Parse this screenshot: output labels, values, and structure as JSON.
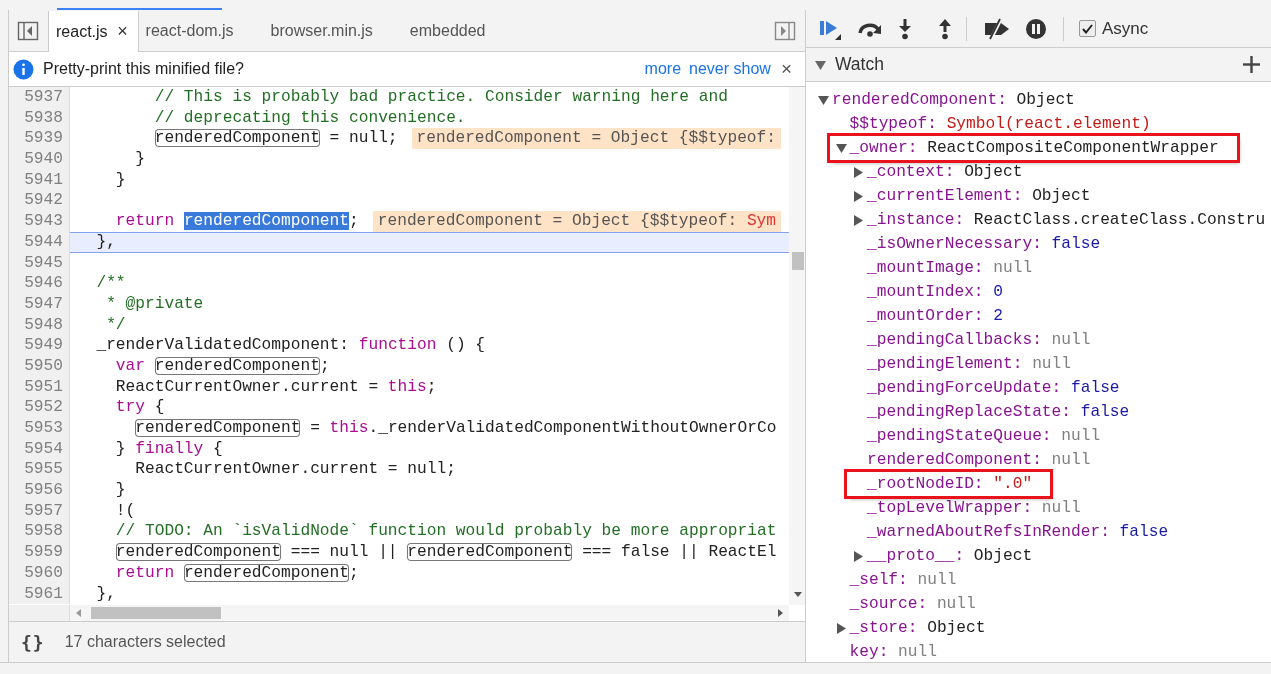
{
  "source_tabs": [
    {
      "label": "react.js",
      "selected": true,
      "close": "×"
    },
    {
      "label": "react-dom.js",
      "selected": false
    },
    {
      "label": "browser.min.js",
      "selected": false
    },
    {
      "label": "embedded",
      "selected": false
    }
  ],
  "infobar": {
    "message": "Pretty-print this minified file?",
    "links": [
      "more",
      "never show"
    ],
    "close": "×"
  },
  "code": {
    "lines": [
      {
        "number": "5937",
        "current": false,
        "tokens": [
          {
            "kind": "comment",
            "text": "        // This is probably bad practice. Consider warning here and"
          }
        ]
      },
      {
        "number": "5938",
        "current": false,
        "tokens": [
          {
            "kind": "comment",
            "text": "        // deprecating this convenience."
          }
        ]
      },
      {
        "number": "5939",
        "current": false,
        "tokens": [
          {
            "kind": "var",
            "text": "        renderedComponent"
          },
          {
            "kind": "text",
            "text": " = null;"
          }
        ],
        "inline": {
          "text": "renderedComponent = Object {$$typeof:"
        }
      },
      {
        "number": "5940",
        "current": false,
        "tokens": [
          {
            "kind": "text",
            "text": "      }"
          }
        ]
      },
      {
        "number": "5941",
        "current": false,
        "tokens": [
          {
            "kind": "text",
            "text": "    }"
          }
        ]
      },
      {
        "number": "5942",
        "current": false
      },
      {
        "number": "5943",
        "current": false,
        "tokens": [
          {
            "kind": "keyword",
            "text": "    return "
          },
          {
            "kind": "selection",
            "text": "renderedComponent"
          },
          {
            "kind": "text",
            "text": ";"
          }
        ],
        "inline": {
          "text": "renderedComponent = Object {$$typeof: ",
          "symbol": "Sym"
        }
      },
      {
        "number": "5944",
        "current": true,
        "tokens": [
          {
            "kind": "text",
            "text": "  },"
          }
        ]
      },
      {
        "number": "5945",
        "current": false
      },
      {
        "number": "5946",
        "current": false,
        "tokens": [
          {
            "kind": "comment",
            "text": "  /**"
          }
        ]
      },
      {
        "number": "5947",
        "current": false,
        "tokens": [
          {
            "kind": "comment",
            "text": "   * @private"
          }
        ]
      },
      {
        "number": "5948",
        "current": false,
        "tokens": [
          {
            "kind": "comment",
            "text": "   */"
          }
        ]
      },
      {
        "number": "5949",
        "current": false,
        "tokens": [
          {
            "kind": "text",
            "text": "  _renderValidatedComponent: "
          },
          {
            "kind": "keyword",
            "text": "function"
          },
          {
            "kind": "text",
            "text": " () {"
          }
        ]
      },
      {
        "number": "5950",
        "current": false,
        "tokens": [
          {
            "kind": "keyword",
            "text": "    var "
          },
          {
            "kind": "var",
            "text": "renderedComponent"
          },
          {
            "kind": "text",
            "text": ";"
          }
        ]
      },
      {
        "number": "5951",
        "current": false,
        "tokens": [
          {
            "kind": "text",
            "text": "    ReactCurrentOwner.current = "
          },
          {
            "kind": "keyword",
            "text": "this"
          },
          {
            "kind": "text",
            "text": ";"
          }
        ]
      },
      {
        "number": "5952",
        "current": false,
        "tokens": [
          {
            "kind": "keyword",
            "text": "    try"
          },
          {
            "kind": "text",
            "text": " {"
          }
        ]
      },
      {
        "number": "5953",
        "current": false,
        "tokens": [
          {
            "kind": "var",
            "text": "      renderedComponent"
          },
          {
            "kind": "text",
            "text": " = "
          },
          {
            "kind": "keyword",
            "text": "this"
          },
          {
            "kind": "text",
            "text": "._renderValidatedComponentWithoutOwnerOrCo"
          }
        ]
      },
      {
        "number": "5954",
        "current": false,
        "tokens": [
          {
            "kind": "text",
            "text": "    } "
          },
          {
            "kind": "keyword",
            "text": "finally"
          },
          {
            "kind": "text",
            "text": " {"
          }
        ]
      },
      {
        "number": "5955",
        "current": false,
        "tokens": [
          {
            "kind": "text",
            "text": "      ReactCurrentOwner.current = null;"
          }
        ]
      },
      {
        "number": "5956",
        "current": false,
        "tokens": [
          {
            "kind": "text",
            "text": "    }"
          }
        ]
      },
      {
        "number": "5957",
        "current": false,
        "tokens": [
          {
            "kind": "text",
            "text": "    !("
          }
        ]
      },
      {
        "number": "5958",
        "current": false,
        "tokens": [
          {
            "kind": "comment",
            "text": "    // TODO: An `isValidNode` function would probably be more appropriat"
          }
        ]
      },
      {
        "number": "5959",
        "current": false,
        "tokens": [
          {
            "kind": "var",
            "text": "    renderedComponent"
          },
          {
            "kind": "text",
            "text": " === null || "
          },
          {
            "kind": "var",
            "text": "renderedComponent"
          },
          {
            "kind": "text",
            "text": " === false || ReactEl"
          }
        ]
      },
      {
        "number": "5960",
        "current": false,
        "tokens": [
          {
            "kind": "keyword",
            "text": "    return "
          },
          {
            "kind": "var",
            "text": "renderedComponent"
          },
          {
            "kind": "text",
            "text": ";"
          }
        ]
      },
      {
        "number": "5961",
        "current": false,
        "tokens": [
          {
            "kind": "text",
            "text": "  },"
          }
        ]
      }
    ]
  },
  "status_bar": {
    "format_icon": "{}",
    "text": "17 characters selected"
  },
  "debugger_toolbar": {
    "async": {
      "label": "Async",
      "checked": true
    }
  },
  "watch": {
    "title": "Watch",
    "expanded": true,
    "items": [
      {
        "name": "renderedComponent:",
        "value": "Object",
        "kind": "object",
        "expanded": true,
        "annotated": false,
        "children": [
          {
            "name": "$$typeof:",
            "value": "Symbol(react.element)",
            "kind": "string",
            "annotated": false
          },
          {
            "name": "_owner:",
            "value": "ReactCompositeComponentWrapper",
            "kind": "object",
            "expanded": true,
            "annotated": true,
            "children": [
              {
                "name": "_context:",
                "value": "Object",
                "kind": "object",
                "expanded": false,
                "annotated": false
              },
              {
                "name": "_currentElement:",
                "value": "Object",
                "kind": "object",
                "expanded": false,
                "annotated": false
              },
              {
                "name": "_instance:",
                "value": "ReactClass.createClass.Constru",
                "kind": "object",
                "expanded": false,
                "annotated": false
              },
              {
                "name": "_isOwnerNecessary:",
                "value": "false",
                "kind": "boolean",
                "annotated": false
              },
              {
                "name": "_mountImage:",
                "value": "null",
                "kind": "null",
                "annotated": false
              },
              {
                "name": "_mountIndex:",
                "value": "0",
                "kind": "number",
                "annotated": false
              },
              {
                "name": "_mountOrder:",
                "value": "2",
                "kind": "number",
                "annotated": false
              },
              {
                "name": "_pendingCallbacks:",
                "value": "null",
                "kind": "null",
                "annotated": false
              },
              {
                "name": "_pendingElement:",
                "value": "null",
                "kind": "null",
                "annotated": false
              },
              {
                "name": "_pendingForceUpdate:",
                "value": "false",
                "kind": "boolean",
                "annotated": false
              },
              {
                "name": "_pendingReplaceState:",
                "value": "false",
                "kind": "boolean",
                "annotated": false
              },
              {
                "name": "_pendingStateQueue:",
                "value": "null",
                "kind": "null",
                "annotated": false
              },
              {
                "name": "renderedComponent:",
                "value": "null",
                "kind": "null",
                "annotated": false
              },
              {
                "name": "_rootNodeID:",
                "value": "\".0\"",
                "kind": "string",
                "annotated": true
              },
              {
                "name": "_topLevelWrapper:",
                "value": "null",
                "kind": "null",
                "annotated": false
              },
              {
                "name": "_warnedAboutRefsInRender:",
                "value": "false",
                "kind": "boolean",
                "annotated": false
              },
              {
                "name": "__proto__:",
                "value": "Object",
                "kind": "object",
                "expanded": false,
                "annotated": false
              }
            ]
          },
          {
            "name": "_self:",
            "value": "null",
            "kind": "null",
            "annotated": false
          },
          {
            "name": "_source:",
            "value": "null",
            "kind": "null",
            "annotated": false
          },
          {
            "name": "_store:",
            "value": "Object",
            "kind": "object",
            "expanded": false,
            "annotated": false
          },
          {
            "name": "key:",
            "value": "null",
            "kind": "null",
            "annotated": false
          }
        ]
      }
    ]
  }
}
